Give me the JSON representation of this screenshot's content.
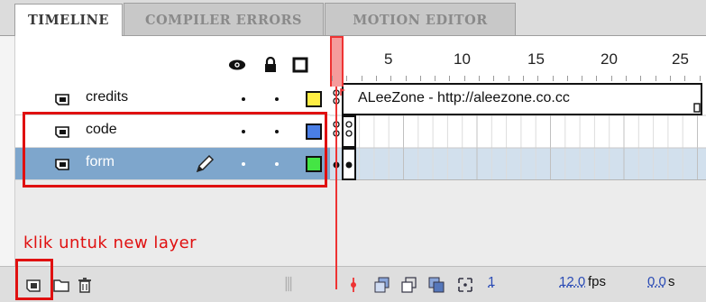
{
  "tabs": [
    {
      "label": "TIMELINE",
      "active": true
    },
    {
      "label": "COMPILER ERRORS",
      "active": false
    },
    {
      "label": "MOTION EDITOR",
      "active": false
    }
  ],
  "header": {
    "icons": [
      "eye-icon",
      "lock-icon",
      "outline-icon"
    ],
    "frame_numbers": [
      "5",
      "10",
      "15",
      "20",
      "25"
    ]
  },
  "layers": [
    {
      "name": "credits",
      "outline_color": "#ffee44",
      "selected": false,
      "tween_label": "ALeeZone - http://aleezone.co.cc"
    },
    {
      "name": "code",
      "outline_color": "#4a7ee6",
      "selected": false
    },
    {
      "name": "form",
      "outline_color": "#44e544",
      "selected": true
    }
  ],
  "annotation": "klik untuk new layer",
  "bottom_bar": {
    "current_frame": "1",
    "fps": "12.0",
    "fps_unit": "fps",
    "time": "0.0",
    "time_unit": "s"
  },
  "colors": {
    "selected_row": "#7ea6cc",
    "playhead": "#ee3333",
    "highlight": "#e01010"
  }
}
